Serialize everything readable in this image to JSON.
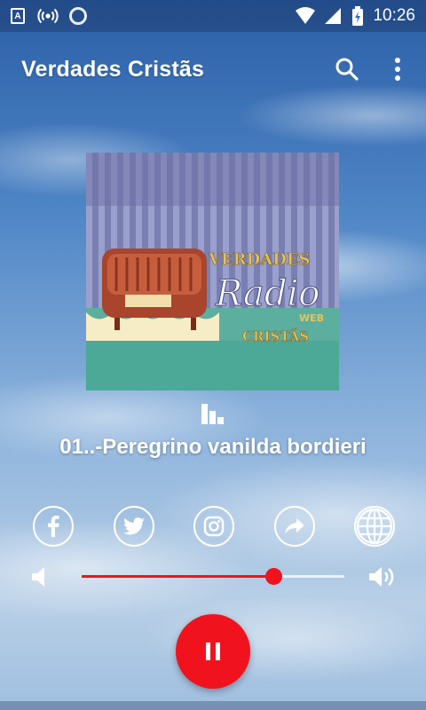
{
  "status_bar": {
    "time": "10:26"
  },
  "app_bar": {
    "title": "Verdades Cristãs"
  },
  "artwork": {
    "line1": "VERDADES",
    "line2": "Radio",
    "line3": "WEB",
    "line4": "CRISTÃS"
  },
  "player": {
    "track_title": "01..-Peregrino vanilda bordieri",
    "volume_fraction": 0.73
  },
  "colors": {
    "accent": "#f0131e"
  },
  "icons": {
    "status": [
      "font-icon",
      "broadcast-icon",
      "circle-icon",
      "wifi-icon",
      "signal-icon",
      "battery-icon"
    ],
    "app_bar": [
      "search-icon",
      "more-vert-icon"
    ],
    "social": [
      "facebook-icon",
      "twitter-icon",
      "instagram-icon",
      "share-icon",
      "globe-icon"
    ],
    "volume": [
      "volume-low-icon",
      "volume-high-icon"
    ],
    "playback": "pause-icon"
  }
}
